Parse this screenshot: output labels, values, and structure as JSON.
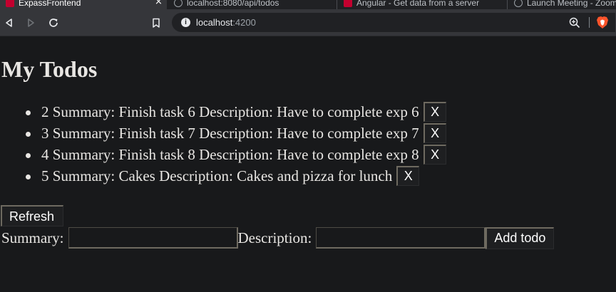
{
  "browser": {
    "tabs": [
      {
        "label": "ExpassFrontend",
        "icon": "angular-icon",
        "active": true
      },
      {
        "label": "localhost:8080/api/todos",
        "icon": "globe-icon",
        "active": false
      },
      {
        "label": "Angular - Get data from a server",
        "icon": "angular-icon",
        "active": false
      },
      {
        "label": "Launch Meeting - Zoom",
        "icon": "globe-icon",
        "active": false
      }
    ],
    "tab_close": "×",
    "url_host": "localhost",
    "url_port": ":4200",
    "info_icon": "i"
  },
  "page": {
    "title": "My Todos",
    "todos": [
      {
        "id": "2",
        "summary": "Summary: Finish task 6",
        "description": "Description: Have to complete exp 6",
        "delete_label": "X"
      },
      {
        "id": "3",
        "summary": "Summary: Finish task 7",
        "description": "Description: Have to complete exp 7",
        "delete_label": "X"
      },
      {
        "id": "4",
        "summary": "Summary: Finish task 8",
        "description": "Description: Have to complete exp 8",
        "delete_label": "X"
      },
      {
        "id": "5",
        "summary": "Summary: Cakes",
        "description": "Description: Cakes and pizza for lunch",
        "delete_label": "X"
      }
    ],
    "refresh_label": "Refresh",
    "form": {
      "summary_label": "Summary:",
      "summary_value": "",
      "description_label": "Description:",
      "description_value": "",
      "add_label": "Add todo"
    }
  },
  "colors": {
    "page_bg": "#18191b",
    "text": "#e8e6e3",
    "toolbar_bg": "#35363a",
    "brave_accent": "#fb542b"
  }
}
